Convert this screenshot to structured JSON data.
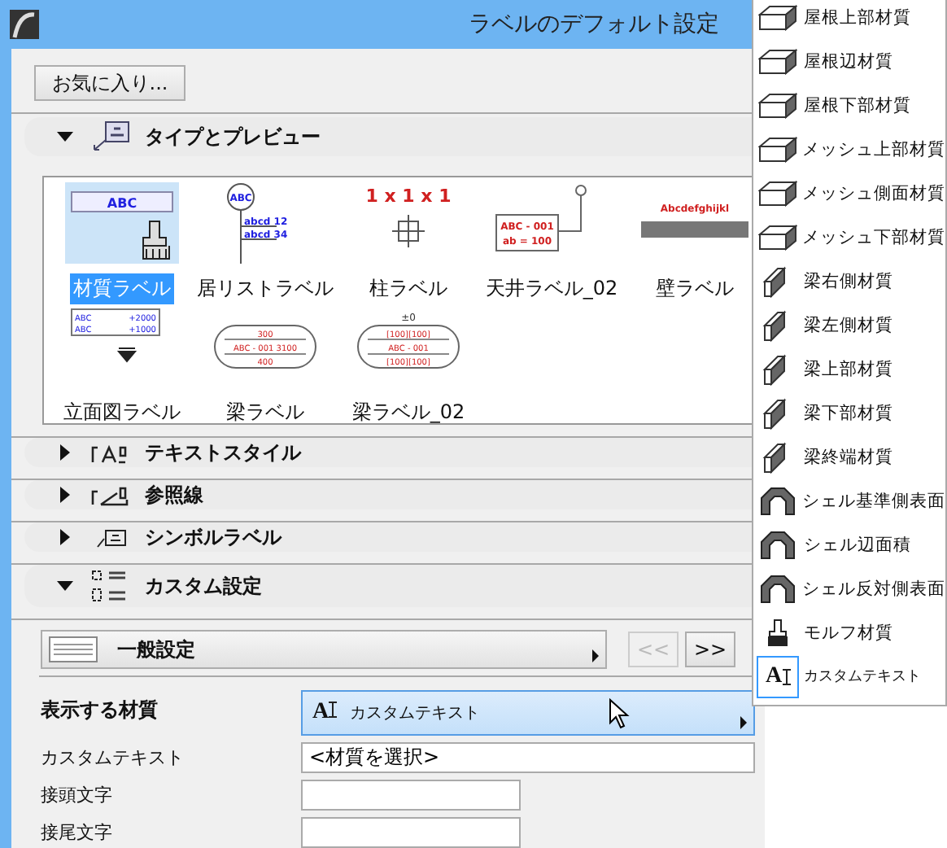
{
  "window": {
    "title": "ラベルのデフォルト設定"
  },
  "favorites_button": "お気に入り...",
  "sections": [
    {
      "title": "タイプとプレビュー",
      "expanded": true,
      "kind": "preview"
    },
    {
      "title": "テキストスタイル",
      "expanded": false,
      "kind": "text-style"
    },
    {
      "title": "参照線",
      "expanded": false,
      "kind": "leader"
    },
    {
      "title": "シンボルラベル",
      "expanded": false,
      "kind": "symbol"
    },
    {
      "title": "カスタム設定",
      "expanded": true,
      "kind": "custom"
    }
  ],
  "label_types": [
    {
      "name": "材質ラベル",
      "selected": true,
      "kind": "material",
      "preview": [
        "ABC"
      ]
    },
    {
      "name": "居リストラベル",
      "selected": false,
      "kind": "room",
      "preview": [
        "ABC",
        "abcd 12",
        "abcd 34"
      ]
    },
    {
      "name": "柱ラベル",
      "selected": false,
      "kind": "column",
      "preview": [
        "1 x 1 x 1"
      ]
    },
    {
      "name": "天井ラベル_02",
      "selected": false,
      "kind": "ceiling",
      "preview": [
        "ABC - 001",
        "ab = 100"
      ]
    },
    {
      "name": "壁ラベル",
      "selected": false,
      "kind": "wall",
      "preview": [
        "Abcdefghijkl"
      ]
    },
    {
      "name": "立面図ラベル",
      "selected": false,
      "kind": "elevation",
      "preview": [
        "ABC",
        "+2000",
        "ABC",
        "+1000"
      ]
    },
    {
      "name": "梁ラベル",
      "selected": false,
      "kind": "beam",
      "preview": [
        "300",
        "ABC - 001  3100",
        "400"
      ]
    },
    {
      "name": "梁ラベル_02",
      "selected": false,
      "kind": "beam2",
      "preview": [
        "±0",
        "[100][100]",
        "ABC - 001",
        "[100][100]"
      ]
    }
  ],
  "custom": {
    "panel_dropdown": "一般設定",
    "prev_button": {
      "label": "<<",
      "disabled": true
    },
    "next_button": {
      "label": ">>",
      "disabled": false
    },
    "material_label": "表示する材質",
    "material_icon_letter": "A",
    "material_value": "カスタムテキスト",
    "fields": [
      {
        "label": "カスタムテキスト",
        "value": "<材質を選択>",
        "wide": true
      },
      {
        "label": "接頭文字",
        "wide": false
      },
      {
        "label": "接尾文字",
        "wide": false
      }
    ]
  },
  "menu": {
    "items": [
      {
        "label": "屋根上部材質",
        "kind": "box",
        "selected": false
      },
      {
        "label": "屋根辺材質",
        "kind": "box",
        "selected": false
      },
      {
        "label": "屋根下部材質",
        "kind": "box",
        "selected": false
      },
      {
        "label": "メッシュ上部材質",
        "kind": "box",
        "selected": false
      },
      {
        "label": "メッシュ側面材質",
        "kind": "box",
        "selected": false
      },
      {
        "label": "メッシュ下部材質",
        "kind": "box",
        "selected": false
      },
      {
        "label": "梁右側材質",
        "kind": "beam",
        "selected": false
      },
      {
        "label": "梁左側材質",
        "kind": "beam",
        "selected": false
      },
      {
        "label": "梁上部材質",
        "kind": "beam",
        "selected": false
      },
      {
        "label": "梁下部材質",
        "kind": "beam",
        "selected": false
      },
      {
        "label": "梁終端材質",
        "kind": "beam",
        "selected": false
      },
      {
        "label": "シェル基準側表面",
        "kind": "shell",
        "selected": false
      },
      {
        "label": "シェル辺面積",
        "kind": "shell",
        "selected": false
      },
      {
        "label": "シェル反対側表面",
        "kind": "shell",
        "selected": false
      },
      {
        "label": "モルフ材質",
        "kind": "morph",
        "selected": false
      },
      {
        "label": "カスタムテキスト",
        "kind": "text",
        "letter": "A",
        "selected": true
      }
    ]
  }
}
